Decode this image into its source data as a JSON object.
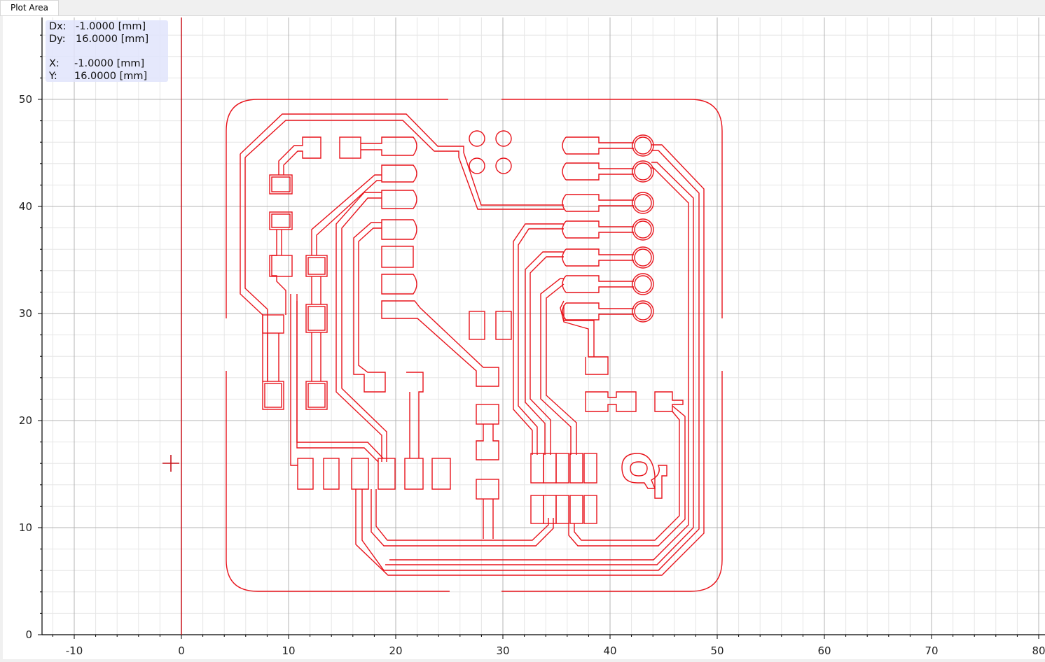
{
  "tab": {
    "label": "Plot Area"
  },
  "readout": {
    "dx_label": "Dx:",
    "dx_value": "-1.0000 [mm]",
    "dy_label": "Dy:",
    "dy_value": "16.0000 [mm]",
    "x_label": "X:",
    "x_value": "-1.0000 [mm]",
    "y_label": "Y:",
    "y_value": "16.0000 [mm]"
  },
  "axes": {
    "x_ticks": [
      "-10",
      "0",
      "10",
      "20",
      "30",
      "40",
      "50",
      "60",
      "70",
      "80"
    ],
    "y_ticks": [
      "0",
      "10",
      "20",
      "30",
      "40",
      "50"
    ]
  },
  "colors": {
    "trace": "#e8141c",
    "cursor": "#c8131b",
    "grid_major": "#b4b4b4",
    "grid_minor": "#e6e6e6"
  }
}
